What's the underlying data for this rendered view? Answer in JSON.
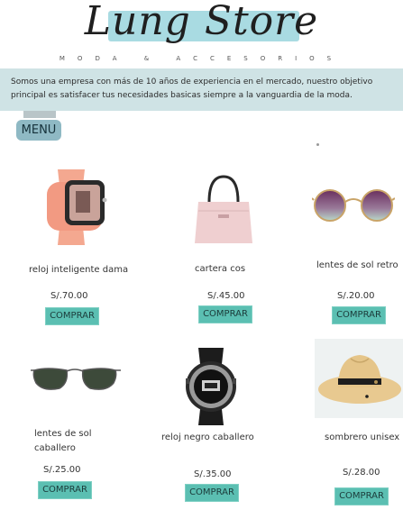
{
  "brand": {
    "name": "Lung Store",
    "tagline": "MODA & ACCESORIOS"
  },
  "intro": {
    "text": "Somos una empresa con más de 10 años de experiencia en el mercado, nuestro objetivo principal es satisfacer tus necesidades basicas siempre a la vanguardia de la moda."
  },
  "menu": {
    "label": "MENU"
  },
  "products": [
    {
      "name": "reloj inteligente dama",
      "price": "S/.70.00",
      "buy_label": "COMPRAR",
      "icon": "smartwatch-pink"
    },
    {
      "name": "cartera cos",
      "price": "S/.45.00",
      "buy_label": "COMPRAR",
      "icon": "handbag-pink"
    },
    {
      "name": "lentes de sol retro",
      "price": "S/.20.00",
      "buy_label": "COMPRAR",
      "icon": "round-sunglasses"
    },
    {
      "name": "lentes de sol caballero",
      "price": "S/.25.00",
      "buy_label": "COMPRAR",
      "icon": "aviator-sunglasses"
    },
    {
      "name": "reloj negro caballero",
      "price": "S/.35.00",
      "buy_label": "COMPRAR",
      "icon": "sport-watch-black"
    },
    {
      "name": "sombrero unisex",
      "price": "S/.28.00",
      "buy_label": "COMPRAR",
      "icon": "fedora-hat"
    }
  ],
  "colors": {
    "intro_bg": "#cfe3e5",
    "logo_band": "#a9dbe2",
    "buy_button": "#5bbfb2",
    "menu_button": "#8fb9c4"
  }
}
